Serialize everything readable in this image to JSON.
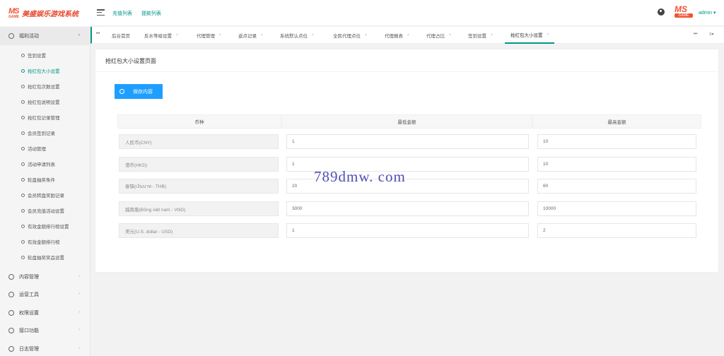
{
  "app": {
    "logo_mark": "MS",
    "logo_mark_sub": "GAME",
    "logo_text": "美盛娱乐游戏系统"
  },
  "header": {
    "links": [
      "充值列表",
      "提款列表"
    ],
    "user": "admin",
    "user_caret": "▾"
  },
  "sidebar": {
    "open_group": {
      "label": "福利活动",
      "arrow": "▾"
    },
    "items": [
      {
        "label": "签到设置"
      },
      {
        "label": "抢红包大小设置",
        "active": true
      },
      {
        "label": "抢红包次数设置"
      },
      {
        "label": "抢红包说明设置"
      },
      {
        "label": "抢红包记录管理"
      },
      {
        "label": "会员签到记录"
      },
      {
        "label": "活动管理"
      },
      {
        "label": "活动申请列表"
      },
      {
        "label": "轮盘抽奖条件"
      },
      {
        "label": "会员转盘奖励记录"
      },
      {
        "label": "会员充值活动设置"
      },
      {
        "label": "有效金额排行榜设置"
      },
      {
        "label": "有效金额排行榜"
      },
      {
        "label": "轮盘抽奖奖品设置"
      }
    ],
    "groups": [
      {
        "label": "内容管理",
        "arrow": "›"
      },
      {
        "label": "运营工具",
        "arrow": "›"
      },
      {
        "label": "权限设置",
        "arrow": "›"
      },
      {
        "label": "接口功能",
        "arrow": "›"
      },
      {
        "label": "日志管理",
        "arrow": "›"
      }
    ]
  },
  "tabs": {
    "nav_left": "⏮",
    "nav_right": "⏭",
    "menu": "≡▾",
    "close_mark": "×",
    "items": [
      {
        "label": "后台首页"
      },
      {
        "label": "反水等级设置"
      },
      {
        "label": "代理管理"
      },
      {
        "label": "返点记录"
      },
      {
        "label": "系统默认点位"
      },
      {
        "label": "全民代理点位"
      },
      {
        "label": "代理报表"
      },
      {
        "label": "代理占比"
      },
      {
        "label": "签到设置"
      },
      {
        "label": "抢红包大小设置",
        "active": true
      }
    ]
  },
  "page": {
    "title": "抢红包大小设置页面",
    "save_label": "保存内容"
  },
  "table": {
    "headers": [
      "币种",
      "最低金额",
      "最高金额"
    ],
    "rows": [
      {
        "currency": "人民币(CNY)",
        "min": "1",
        "max": "10"
      },
      {
        "currency": "港币(HKD)",
        "min": "1",
        "max": "10"
      },
      {
        "currency": "泰铢(เงินบาท - THB)",
        "min": "20",
        "max": "60"
      },
      {
        "currency": "越南盾(Đồng việt nam - VND)",
        "min": "3000",
        "max": "10000"
      },
      {
        "currency": "美元(U.S. dollar - USD)",
        "min": "1",
        "max": "2"
      }
    ]
  },
  "watermark": "789dmw. com"
}
